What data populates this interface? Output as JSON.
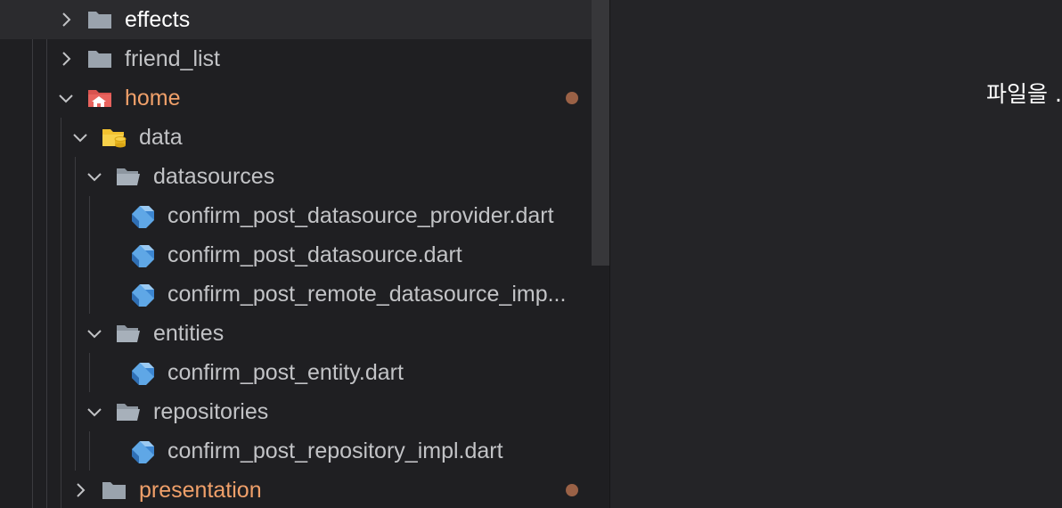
{
  "explorer": {
    "items": [
      {
        "label": "effects",
        "type": "folder",
        "state": "collapsed",
        "icon": "folder-icon"
      },
      {
        "label": "friend_list",
        "type": "folder",
        "state": "collapsed",
        "icon": "folder-icon"
      },
      {
        "label": "home",
        "type": "folder",
        "state": "expanded",
        "icon": "home-folder-icon",
        "modified": true
      },
      {
        "label": "data",
        "type": "folder",
        "state": "expanded",
        "icon": "database-folder-icon"
      },
      {
        "label": "datasources",
        "type": "folder",
        "state": "expanded",
        "icon": "folder-open-icon"
      },
      {
        "label": "confirm_post_datasource_provider.dart",
        "type": "file",
        "icon": "dart-file-icon"
      },
      {
        "label": "confirm_post_datasource.dart",
        "type": "file",
        "icon": "dart-file-icon"
      },
      {
        "label": "confirm_post_remote_datasource_imp...",
        "type": "file",
        "icon": "dart-file-icon"
      },
      {
        "label": "entities",
        "type": "folder",
        "state": "expanded",
        "icon": "folder-open-icon"
      },
      {
        "label": "confirm_post_entity.dart",
        "type": "file",
        "icon": "dart-file-icon"
      },
      {
        "label": "repositories",
        "type": "folder",
        "state": "expanded",
        "icon": "folder-open-icon"
      },
      {
        "label": "confirm_post_repository_impl.dart",
        "type": "file",
        "icon": "dart-file-icon"
      },
      {
        "label": "presentation",
        "type": "folder",
        "state": "collapsed",
        "icon": "folder-icon",
        "modified": true
      }
    ],
    "modified_color": "#9a6146",
    "modified_label_color": "#f0a06a"
  },
  "editor": {
    "message": "파일을 ..."
  }
}
